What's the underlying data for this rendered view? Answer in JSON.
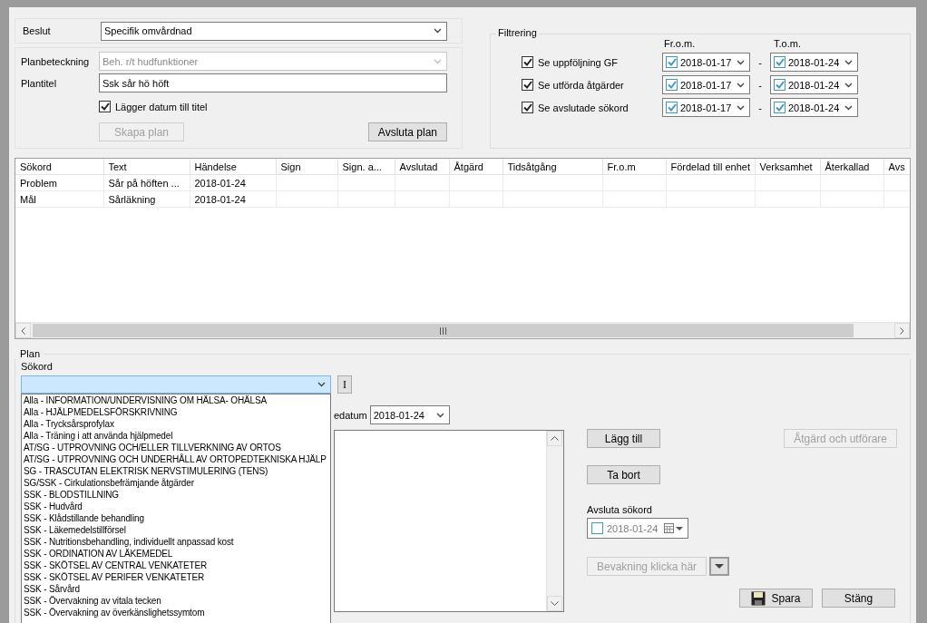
{
  "decision": {
    "label": "Beslut",
    "value": "Specifik omvårdnad"
  },
  "plan_designation": {
    "label": "Planbeteckning",
    "value": "Beh. r/t hudfunktioner",
    "disabled": true
  },
  "plan_title": {
    "label": "Plantitel",
    "value": "Ssk sår hö höft"
  },
  "add_date": {
    "label": "Lägger datum till titel",
    "checked": true
  },
  "plan_buttons": [
    {
      "label": "Skapa plan",
      "disabled": true
    },
    {
      "label": "Avsluta plan",
      "disabled": false
    }
  ],
  "filter": {
    "title": "Filtrering",
    "from_header": "Fr.o.m.",
    "to_header": "T.o.m.",
    "rows": [
      {
        "label": "Se uppföljning GF",
        "checked": true,
        "from": "2018-01-17",
        "from_checked": true,
        "separator": "-",
        "to": "2018-01-24",
        "to_checked": true
      },
      {
        "label": "Se utförda åtgärder",
        "checked": true,
        "from": "2018-01-17",
        "from_checked": true,
        "separator": "-",
        "to": "2018-01-24",
        "to_checked": true
      },
      {
        "label": "Se avslutade sökord",
        "checked": true,
        "from": "2018-01-17",
        "from_checked": true,
        "separator": "-",
        "to": "2018-01-24",
        "to_checked": true
      }
    ]
  },
  "table": {
    "columns": [
      "Sökord",
      "Text",
      "Händelse",
      "Sign",
      "Sign. a...",
      "Avslutad",
      "Åtgärd",
      "Tidsåtgång",
      "Fr.o.m",
      "Fördelad till enhet",
      "Verksamhet",
      "Återkallad",
      "Avs"
    ],
    "rows": [
      {
        "cells": [
          "Problem",
          "Sår på höften ...",
          "2018-01-24"
        ]
      },
      {
        "cells": [
          "Mål",
          "Sårläkning",
          "2018-01-24"
        ]
      }
    ]
  },
  "plan": {
    "title": "Plan",
    "keyword_label": "Sökord",
    "info_button": "I",
    "keyword_options": [
      "Alla - INFORMATION/UNDERVISNING OM HÄLSA- OHÄLSA",
      "Alla - HJÄLPMEDELSFÖRSKRIVNING",
      "Alla - Trycksårsprofylax",
      "Alla - Träning i att använda hjälpmedel",
      "AT/SG - UTPROVNING OCH/ELLER TILLVERKNING AV ORTOS",
      "AT/SG - UTPROVNING OCH UNDERHÅLL AV ORTOPEDTEKNISKA HJÄLP",
      "SG - TRASCUTAN ELEKTRISK NERVSTIMULERING (TENS)",
      "SG/SSK - Cirkulationsbefrämjande åtgärder",
      "SSK - BLODSTILLNING",
      "SSK - Hudvård",
      "SSK - Klådstillande behandling",
      "SSK - Läkemedelstillförsel",
      "SSK - Nutritionsbehandling, individuellt anpassad kost",
      "SSK - ORDINATION AV LÄKEMEDEL",
      "SSK - SKÖTSEL AV CENTRAL VENKATETER",
      "SSK - SKÖTSEL AV PERIFER VENKATETER",
      "SSK - Sårvård",
      "SSK - Övervakning av vitala tecken",
      "SSK - Övervakning av överkänslighetssymtom"
    ],
    "date_label": "edatum",
    "date_value": "2018-01-24",
    "add_button": "Lägg till",
    "remove_button": "Ta bort",
    "action_button": {
      "label": "Åtgärd och utförare",
      "disabled": true
    },
    "close_keyword": {
      "label": "Avsluta sökord",
      "date": "2018-01-24",
      "checked": false
    },
    "watch_button": {
      "label": "Bevakning klicka här",
      "disabled": true
    },
    "save_button": "Spara",
    "close_button": "Stäng"
  }
}
